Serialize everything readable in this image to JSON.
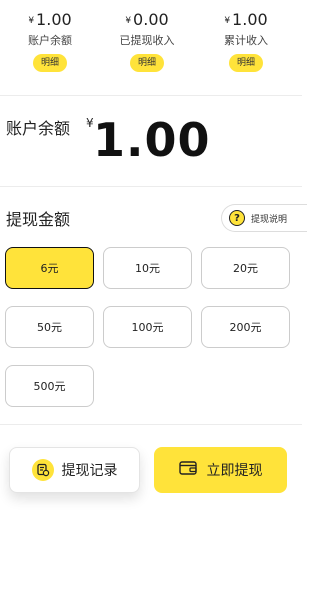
{
  "stats": [
    {
      "currency": "¥",
      "amount": "1.00",
      "label": "账户余额",
      "badge": "明细"
    },
    {
      "currency": "¥",
      "amount": "0.00",
      "label": "已提现收入",
      "badge": "明细"
    },
    {
      "currency": "¥",
      "amount": "1.00",
      "label": "累计收入",
      "badge": "明细"
    }
  ],
  "balance": {
    "label": "账户余额",
    "currency": "¥",
    "amount": "1.00"
  },
  "withdraw": {
    "title": "提现金额",
    "explain_label": "提现说明",
    "explain_icon": "question-icon",
    "options": [
      "6元",
      "10元",
      "20元",
      "50元",
      "100元",
      "200元",
      "500元"
    ],
    "selected": "6元"
  },
  "actions": {
    "record_label": "提现记录",
    "record_icon": "record-icon",
    "withdraw_label": "立即提现",
    "withdraw_icon": "wallet-icon"
  },
  "colors": {
    "accent": "#ffe33a",
    "text": "#222222",
    "border": "#cccccc"
  }
}
